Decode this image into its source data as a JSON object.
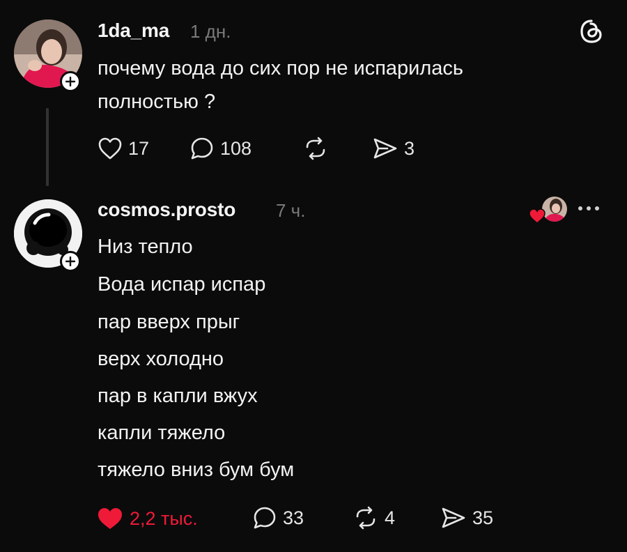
{
  "post": {
    "username": "1da_ma",
    "time": "1 дн.",
    "lines": [
      "почему  вода до сих пор не испарилась",
      "полностью ?"
    ],
    "likes": "17",
    "replies": "108",
    "shares": "3"
  },
  "reply": {
    "username": "cosmos.prosto",
    "time": "7 ч.",
    "lines": [
      "Низ тепло",
      "Вода испар испар",
      "пар вверх прыг",
      "верх холодно",
      "пар в капли вжух",
      "капли тяжело",
      "тяжело вниз бум бум"
    ],
    "likes": "2,2 тыс.",
    "replies": "33",
    "reposts": "4",
    "shares": "35"
  },
  "icons": {
    "app_logo": "threads-logo-icon",
    "follow": "plus-icon",
    "like": "heart-icon",
    "reply": "speech-bubble-icon",
    "repost": "repost-arrows-icon",
    "share": "send-arrow-icon",
    "more": "more-dots-icon",
    "author_liked": "author-liked-heart-icon"
  },
  "colors": {
    "background": "#0b0b0b",
    "text": "#f3f3f3",
    "muted": "#7a7a7a",
    "liked": "#ef1a38"
  }
}
